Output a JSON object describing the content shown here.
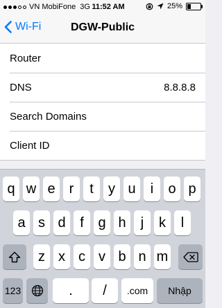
{
  "status_bar": {
    "carrier": "VN MobiFone",
    "network": "3G",
    "time": "11:52 AM",
    "battery": "25%",
    "battery_level": 0.25
  },
  "nav": {
    "back_label": "Wi-Fi",
    "title": "DGW-Public"
  },
  "rows": [
    {
      "label": "Router",
      "value": ""
    },
    {
      "label": "DNS",
      "value": "8.8.8.8"
    },
    {
      "label": "Search Domains",
      "value": ""
    },
    {
      "label": "Client ID",
      "value": ""
    }
  ],
  "keyboard": {
    "row1": [
      "q",
      "w",
      "e",
      "r",
      "t",
      "y",
      "u",
      "i",
      "o",
      "p"
    ],
    "row2": [
      "a",
      "s",
      "d",
      "f",
      "g",
      "h",
      "j",
      "k",
      "l"
    ],
    "row3": [
      "z",
      "x",
      "c",
      "v",
      "b",
      "n",
      "m"
    ],
    "numbers_label": "123",
    "period_label": ".",
    "slash_label": "/",
    "dotcom_label": ".com",
    "return_label": "Nhập"
  }
}
